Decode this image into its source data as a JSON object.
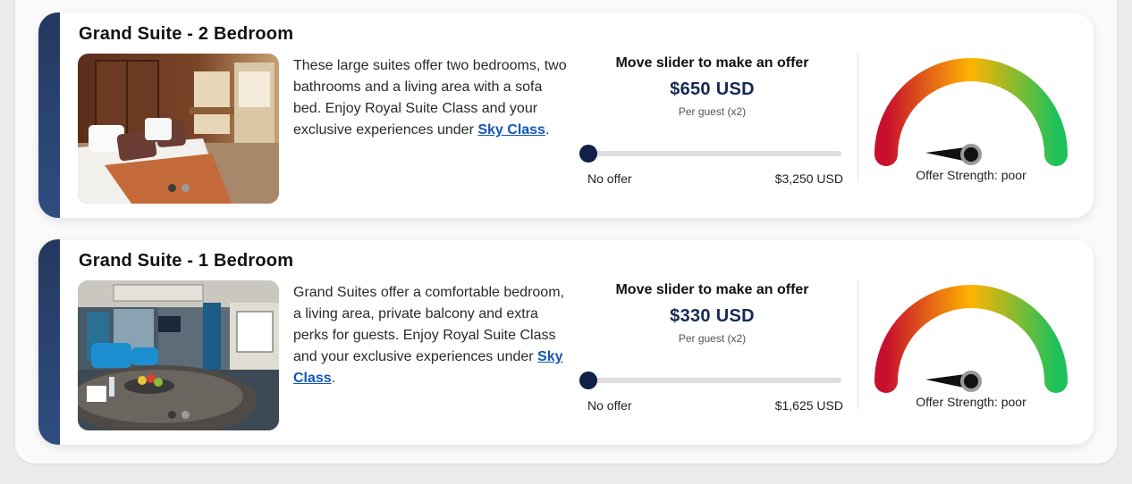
{
  "cards": [
    {
      "title": "Grand Suite - 2 Bedroom",
      "description": "These large suites offer two bedrooms, two bathrooms and a living area with a sofa bed. Enjoy Royal Suite Class and your exclusive experiences under ",
      "link_text": "Sky Class",
      "description_end": ".",
      "offer_heading": "Move slider to make an offer",
      "price": "$650 USD",
      "per_guest": "Per guest (x2)",
      "slider_min_label": "No offer",
      "slider_max_label": "$3,250 USD",
      "slider_position": 0,
      "strength_label": "Offer Strength: poor",
      "photo_subject": "bedroom-photo",
      "carousel": {
        "count": 2,
        "active": 0
      }
    },
    {
      "title": "Grand Suite - 1 Bedroom",
      "description": "Grand Suites offer a comfortable bedroom, a living area, private balcony and extra perks for guests. Enjoy Royal Suite Class and your exclusive experiences under ",
      "link_text": "Sky Class",
      "description_end": ".",
      "offer_heading": "Move slider to make an offer",
      "price": "$330 USD",
      "per_guest": "Per guest (x2)",
      "slider_min_label": "No offer",
      "slider_max_label": "$1,625 USD",
      "slider_position": 0,
      "strength_label": "Offer Strength: poor",
      "photo_subject": "living-room-photo",
      "carousel": {
        "count": 2,
        "active": 0
      }
    }
  ],
  "colors": {
    "accent_bar": "#24385f",
    "price": "#152a55",
    "link": "#1258b5",
    "slider_thumb": "#0f2147",
    "gauge_low": "#c8102e",
    "gauge_mid": "#ffb300",
    "gauge_high": "#1ec15a"
  }
}
